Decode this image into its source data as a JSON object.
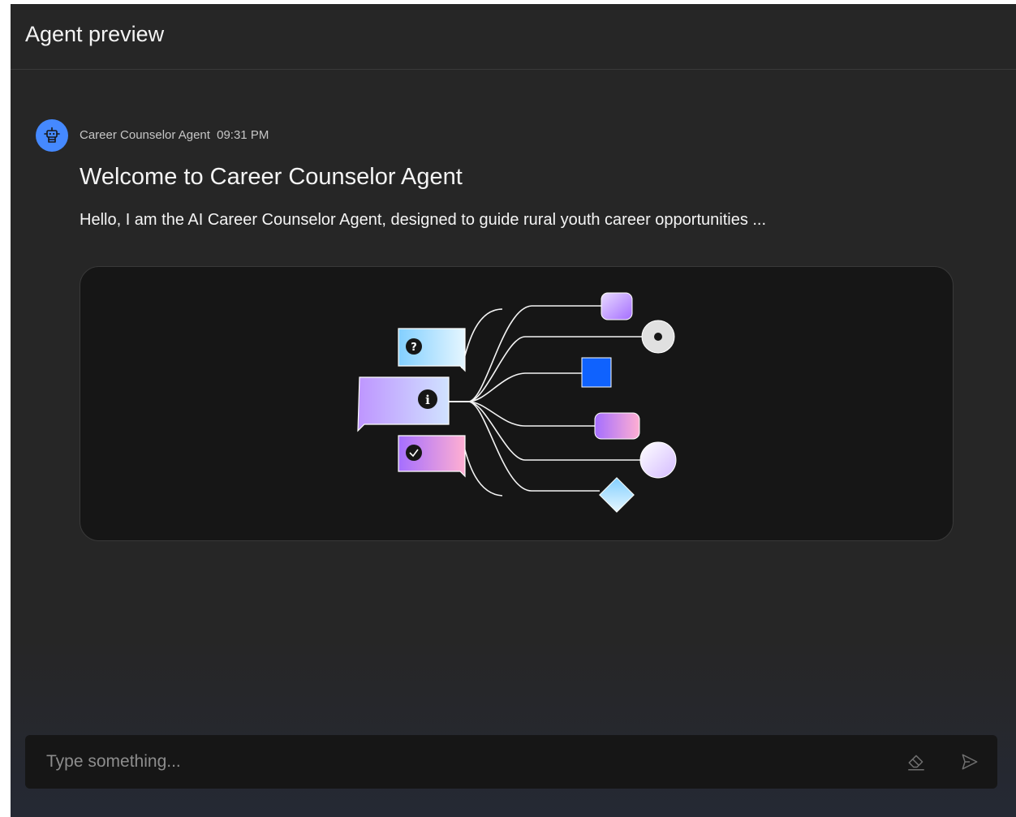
{
  "header": {
    "title": "Agent preview"
  },
  "message": {
    "agent_name": "Career Counselor Agent",
    "time": "09:31 PM",
    "avatar_icon": "robot-icon",
    "title": "Welcome to Career Counselor Agent",
    "text": "Hello, I am the AI Career Counselor Agent, designed to guide rural youth career opportunities ..."
  },
  "composer": {
    "placeholder": "Type something...",
    "value": "",
    "clear_icon": "eraser-icon",
    "send_icon": "send-icon"
  },
  "colors": {
    "panel_bg": "#262626",
    "card_bg": "#161616",
    "accent_blue": "#4589ff",
    "square_blue": "#0f62fe",
    "text_primary": "#f4f4f4",
    "text_secondary": "#c6c6c6",
    "placeholder": "#8d8d8d"
  }
}
